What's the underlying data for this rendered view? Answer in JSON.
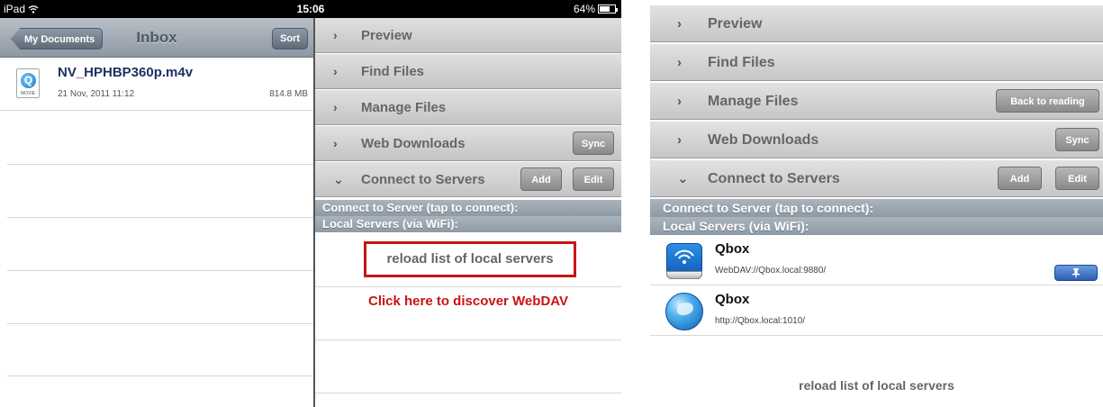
{
  "left": {
    "status_bar": {
      "carrier": "iPad",
      "wifi_icon": "wifi-icon",
      "time": "15:06",
      "battery": "64%",
      "battery_icon": "battery-icon"
    },
    "navbar": {
      "back_label": "My Documents",
      "title": "Inbox",
      "sort_label": "Sort"
    },
    "files": [
      {
        "name": "NV_HPHBP360p.m4v",
        "date": "21 Nov, 2011 11:12",
        "size": "814.8 MB",
        "icon": "quicktime-movie-icon",
        "icon_tag": "MOVIE"
      }
    ],
    "panel": {
      "rows": [
        {
          "chevron": "›",
          "label": "Preview"
        },
        {
          "chevron": "›",
          "label": "Find Files"
        },
        {
          "chevron": "›",
          "label": "Manage Files"
        },
        {
          "chevron": "›",
          "label": "Web Downloads",
          "button": "Sync"
        },
        {
          "chevron": "⌄",
          "label": "Connect to Servers",
          "buttons": [
            "Add",
            "Edit"
          ]
        }
      ],
      "header_connect": "Connect to Server (tap to connect):",
      "header_local": "Local Servers (via WiFi):",
      "reload_label": "reload list of local servers",
      "annotation": "Click here to discover WebDAV",
      "annotation_color": "#c81414"
    }
  },
  "right": {
    "rows": [
      {
        "chevron": "›",
        "label": "Preview"
      },
      {
        "chevron": "›",
        "label": "Find Files"
      },
      {
        "chevron": "›",
        "label": "Manage Files",
        "button": "Back to reading"
      },
      {
        "chevron": "›",
        "label": "Web Downloads",
        "button": "Sync"
      },
      {
        "chevron": "⌄",
        "label": "Connect to Servers",
        "buttons": [
          "Add",
          "Edit"
        ]
      }
    ],
    "header_connect": "Connect to Server (tap to connect):",
    "header_local": "Local Servers (via WiFi):",
    "servers": [
      {
        "name": "Qbox",
        "address": "WebDAV://Qbox.local:9880/",
        "icon": "wifi-drive-icon",
        "pin_icon": "pin-icon"
      },
      {
        "name": "Qbox",
        "address": "http://Qbox.local:1010/",
        "icon": "globe-icon"
      }
    ],
    "reload_label": "reload list of local servers"
  }
}
